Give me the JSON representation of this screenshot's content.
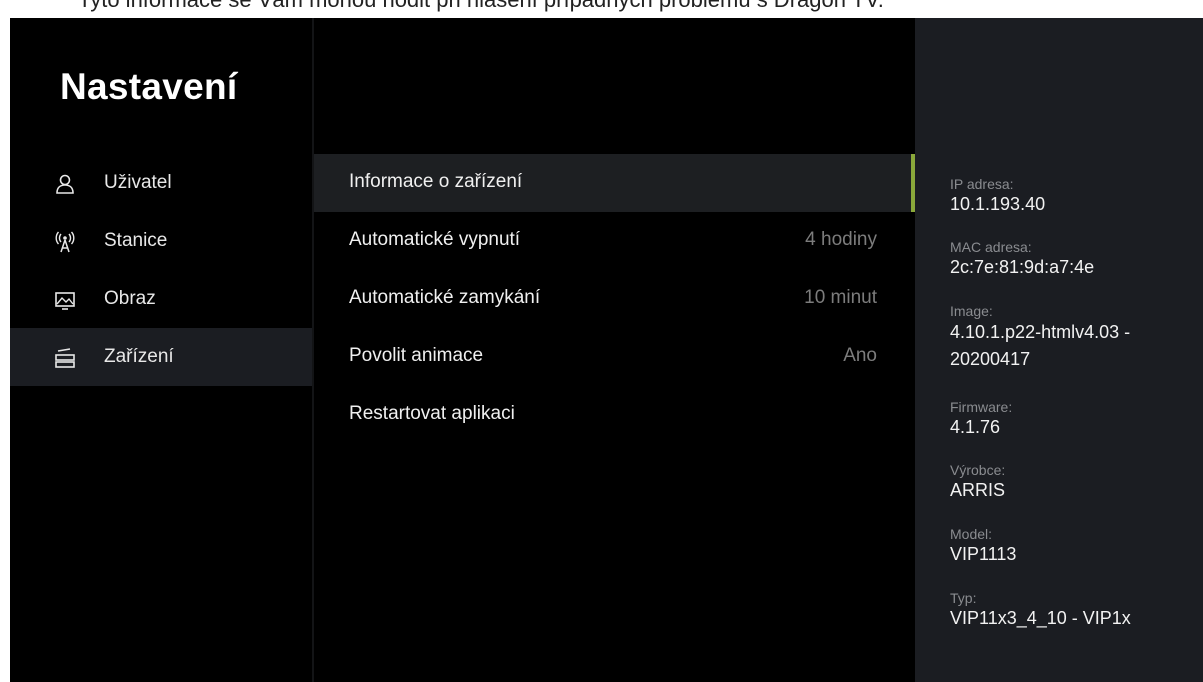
{
  "caption": "Tyto informace se Vám mohou hodit při hlášení případných problémů s Dragon TV.",
  "page_title": "Nastavení",
  "sidebar": {
    "items": [
      {
        "label": "Uživatel",
        "icon": "user-icon"
      },
      {
        "label": "Stanice",
        "icon": "antenna-icon"
      },
      {
        "label": "Obraz",
        "icon": "picture-icon"
      },
      {
        "label": "Zařízení",
        "icon": "device-icon",
        "active": true
      }
    ]
  },
  "menu": {
    "items": [
      {
        "label": "Informace o zařízení",
        "value": "",
        "active": true
      },
      {
        "label": "Automatické vypnutí",
        "value": "4 hodiny"
      },
      {
        "label": "Automatické zamykání",
        "value": "10 minut"
      },
      {
        "label": "Povolit animace",
        "value": "Ano"
      },
      {
        "label": "Restartovat aplikaci",
        "value": ""
      }
    ]
  },
  "info": {
    "rows": [
      {
        "key": "IP adresa:",
        "value": "10.1.193.40"
      },
      {
        "key": "MAC adresa:",
        "value": "2c:7e:81:9d:a7:4e"
      },
      {
        "key": "Image:",
        "value": "4.10.1.p22-htmlv4.03 - 20200417"
      },
      {
        "key": "Firmware:",
        "value": "4.1.76"
      },
      {
        "key": "Výrobce:",
        "value": "ARRIS"
      },
      {
        "key": "Model:",
        "value": "VIP1113"
      },
      {
        "key": "Typ:",
        "value": "VIP11x3_4_10 - VIP1x"
      }
    ]
  },
  "colors": {
    "accent": "#8aa83a",
    "background": "#000000",
    "panel": "#1b1d22",
    "value_text": "#7c7c7c"
  }
}
